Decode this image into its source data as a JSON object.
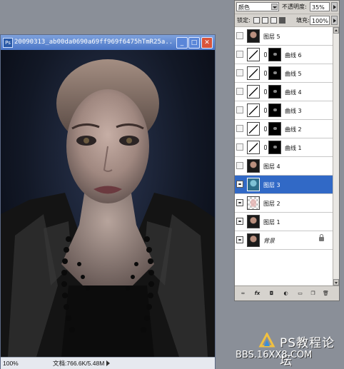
{
  "document_window": {
    "app_icon_text": "Ps",
    "title": "20090313_ab00da0690a69ff969f6475hTmR25a...",
    "status_zoom": "100%",
    "status_info": "文档:766.6K/5.48M"
  },
  "layers_panel": {
    "blend_mode": "颜色",
    "opacity_label": "不透明度:",
    "opacity_value": "35%",
    "lock_label": "锁定:",
    "fill_label": "填充:",
    "fill_value": "100%",
    "layers": [
      {
        "name": "图层 5",
        "visible": false,
        "type": "pixel",
        "selected": false
      },
      {
        "name": "曲线 6",
        "visible": false,
        "type": "curves",
        "selected": false
      },
      {
        "name": "曲线 5",
        "visible": false,
        "type": "curves",
        "selected": false
      },
      {
        "name": "曲线 4",
        "visible": false,
        "type": "curves",
        "selected": false
      },
      {
        "name": "曲线 3",
        "visible": false,
        "type": "curves",
        "selected": false
      },
      {
        "name": "曲线 2",
        "visible": false,
        "type": "curves",
        "selected": false
      },
      {
        "name": "曲线 1",
        "visible": false,
        "type": "curves",
        "selected": false
      },
      {
        "name": "图层 4",
        "visible": false,
        "type": "pixel",
        "selected": false
      },
      {
        "name": "图层 3",
        "visible": true,
        "type": "pixel-teal",
        "selected": true
      },
      {
        "name": "图层 2",
        "visible": true,
        "type": "pixel-checker",
        "selected": false
      },
      {
        "name": "图层 1",
        "visible": true,
        "type": "pixel",
        "selected": false
      },
      {
        "name": "背景",
        "visible": true,
        "type": "background",
        "selected": false
      }
    ],
    "bottom_buttons": [
      "link-icon",
      "fx-icon",
      "mask-icon",
      "adjustment-icon",
      "folder-icon",
      "new-layer-icon",
      "trash-icon"
    ]
  },
  "watermark": {
    "title": "PS教程论坛",
    "subtitle": "BBS.16XX8.COM"
  },
  "colors": {
    "selection": "#3169c6",
    "title_bar": "#4a76c8",
    "panel_bg": "#d6d3ce"
  }
}
